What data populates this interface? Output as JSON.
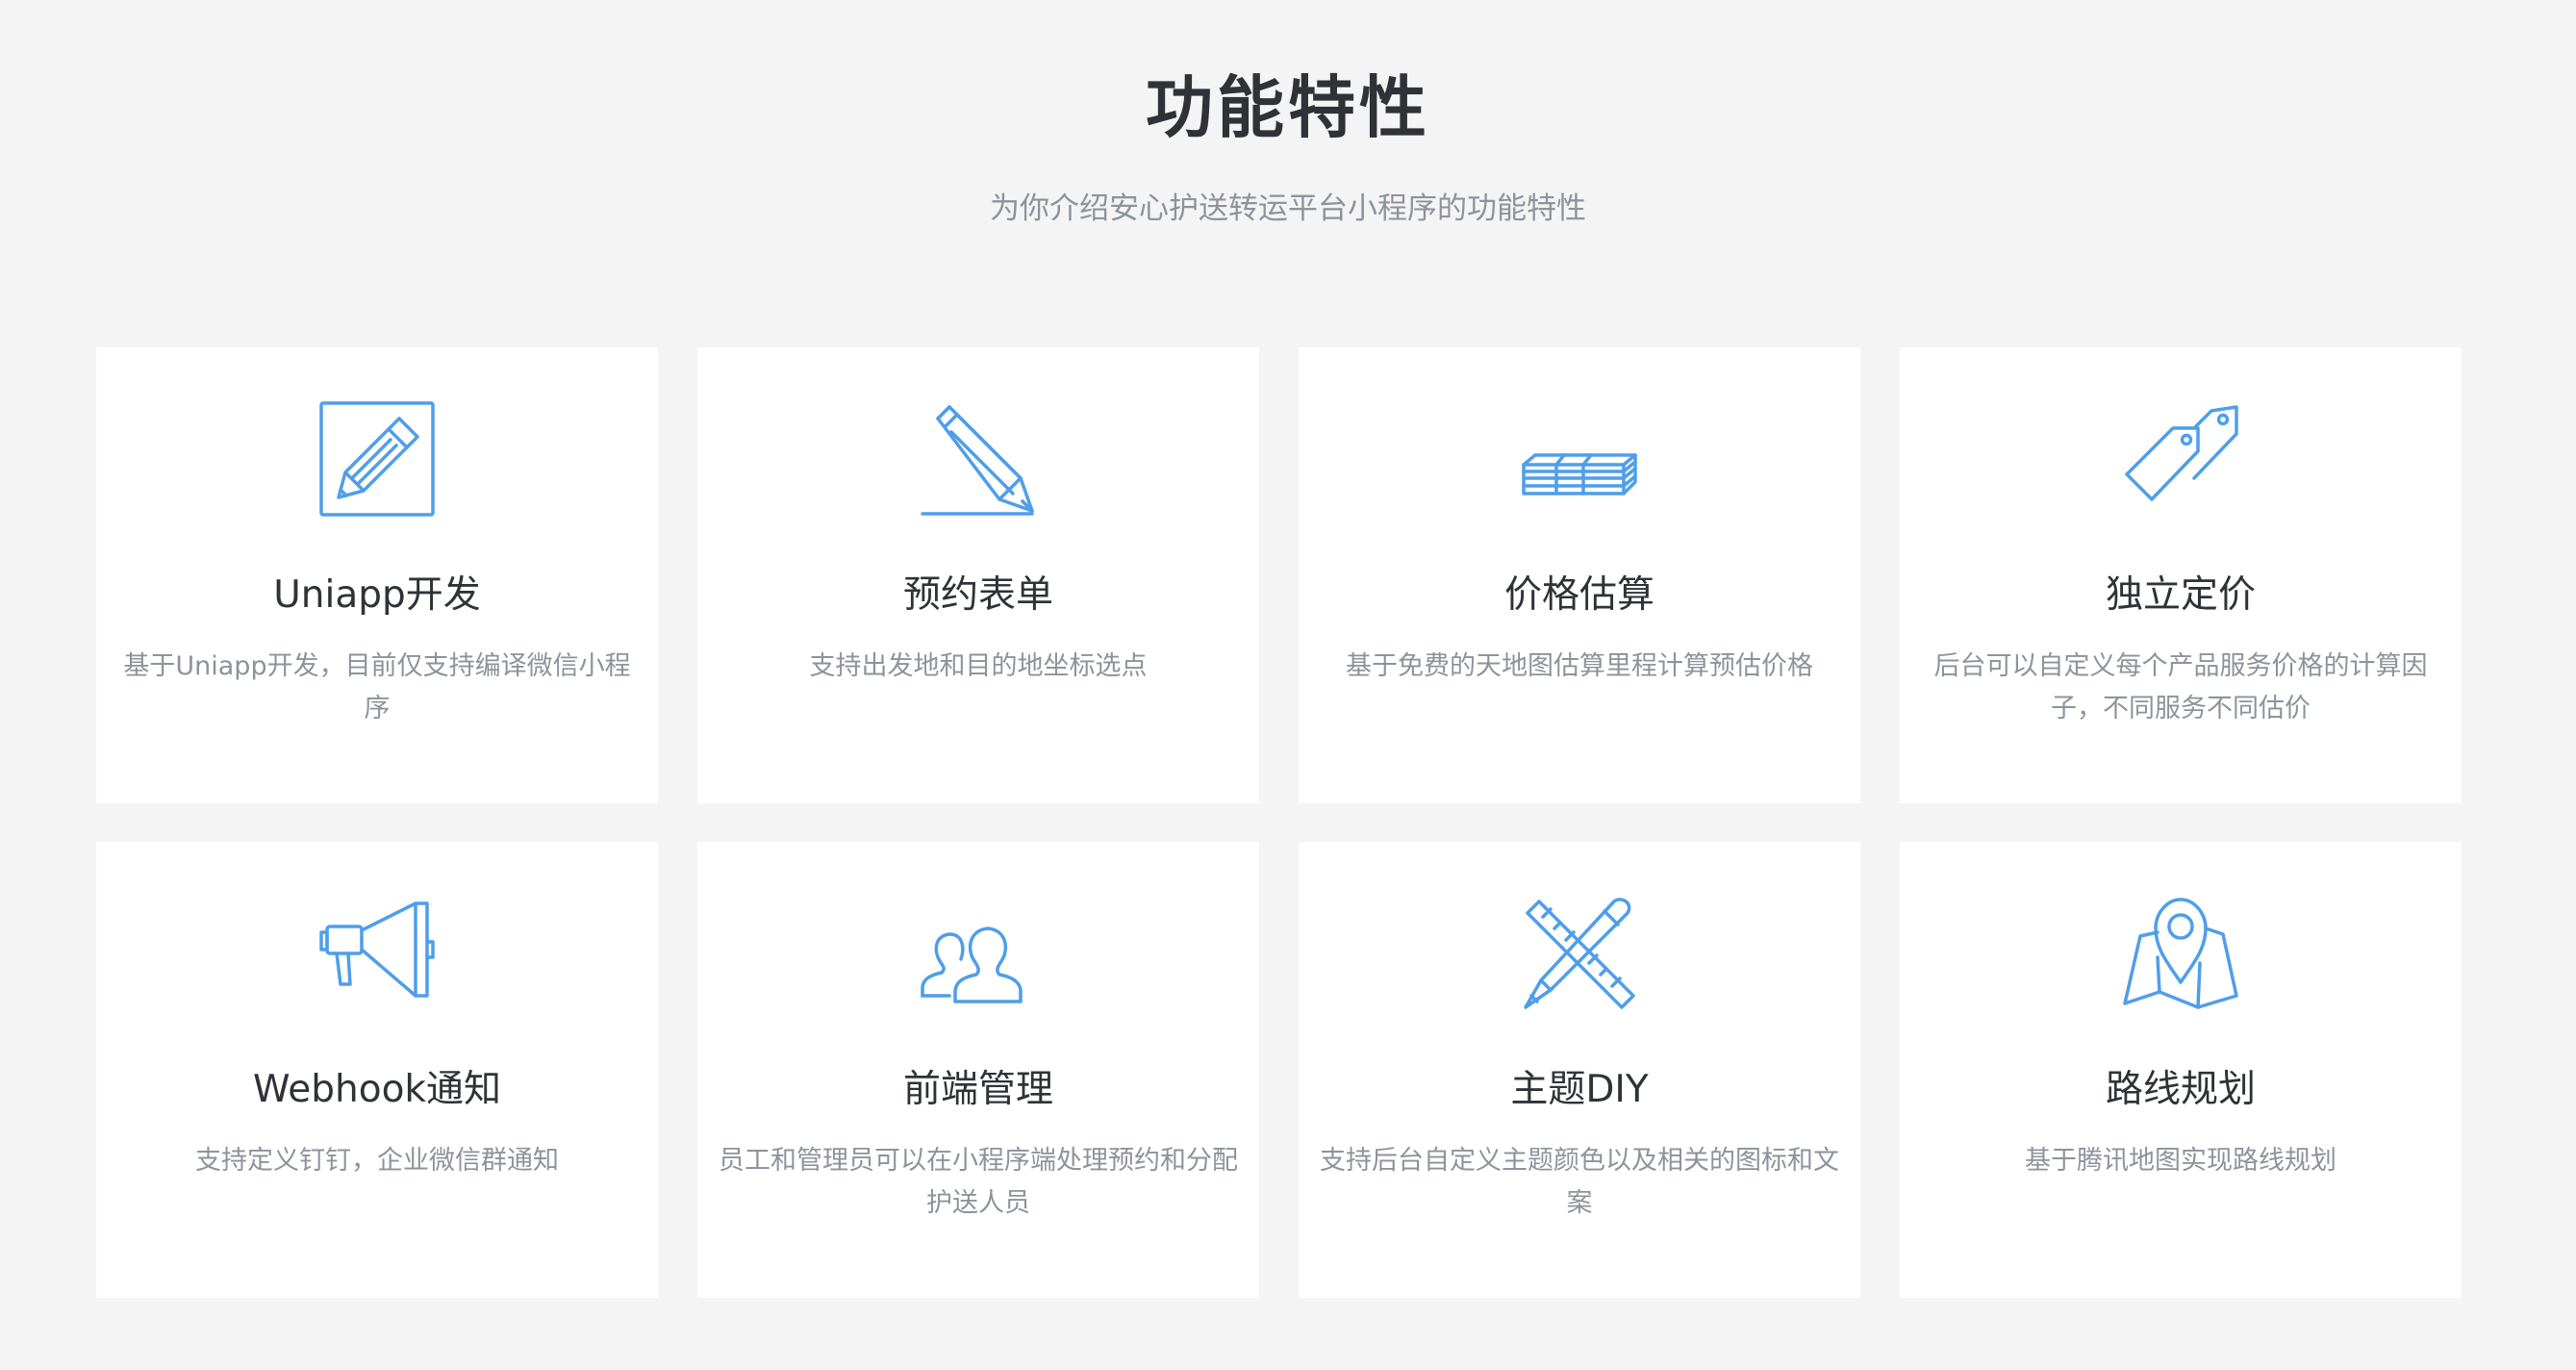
{
  "header": {
    "title": "功能特性",
    "subtitle": "为你介绍安心护送转运平台小程序的功能特性"
  },
  "accent_color": "#4f9eea",
  "cards": [
    {
      "icon": "edit-square-icon",
      "title": "Uniapp开发",
      "desc": "基于Uniapp开发，目前仅支持编译微信小程序"
    },
    {
      "icon": "pencil-icon",
      "title": "预约表单",
      "desc": "支持出发地和目的地坐标选点"
    },
    {
      "icon": "money-stack-icon",
      "title": "价格估算",
      "desc": "基于免费的天地图估算里程计算预估价格"
    },
    {
      "icon": "price-tags-icon",
      "title": "独立定价",
      "desc": "后台可以自定义每个产品服务价格的计算因子，不同服务不同估价"
    },
    {
      "icon": "megaphone-icon",
      "title": "Webhook通知",
      "desc": "支持定义钉钉，企业微信群通知"
    },
    {
      "icon": "users-icon",
      "title": "前端管理",
      "desc": "员工和管理员可以在小程序端处理预约和分配护送人员"
    },
    {
      "icon": "ruler-pencil-icon",
      "title": "主题DIY",
      "desc": "支持后台自定义主题颜色以及相关的图标和文案"
    },
    {
      "icon": "map-pin-icon",
      "title": "路线规划",
      "desc": "基于腾讯地图实现路线规划"
    }
  ]
}
